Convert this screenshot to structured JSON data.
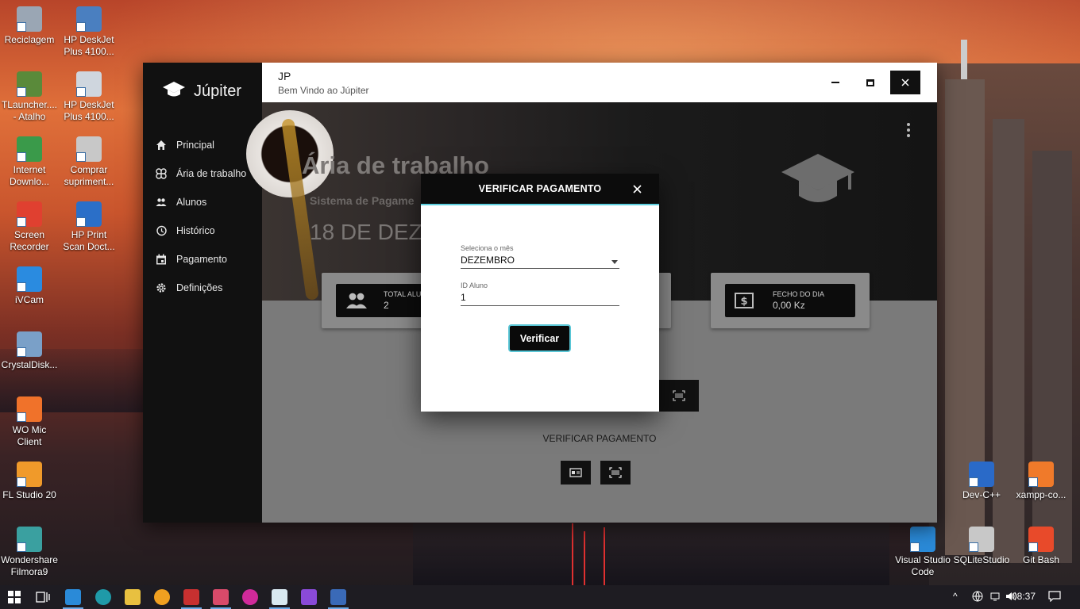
{
  "desktop": {
    "icons_left": [
      {
        "label": "Reciclagem",
        "icon": "recycle-bin-icon",
        "color": "#9aa6b4"
      },
      {
        "label": "HP DeskJet Plus 4100...",
        "icon": "printer-icon",
        "color": "#4a7fc0"
      },
      {
        "label": "TLauncher.... - Atalho",
        "icon": "minecraft-icon",
        "color": "#5a8a3a"
      },
      {
        "label": "HP DeskJet Plus 4100...",
        "icon": "printer-icon",
        "color": "#cfd6de"
      },
      {
        "label": "Internet Downlo...",
        "icon": "download-manager-icon",
        "color": "#3a9a4a"
      },
      {
        "label": "Comprar supriment...",
        "icon": "printer-cart-icon",
        "color": "#c8c8c8"
      },
      {
        "label": "Screen Recorder",
        "icon": "screen-recorder-icon",
        "color": "#e04030"
      },
      {
        "label": "HP Print Scan Doct...",
        "icon": "scan-doctor-icon",
        "color": "#2b6fc8"
      },
      {
        "label": "iVCam",
        "icon": "webcam-icon",
        "color": "#2a8be0"
      },
      {
        "label": "CrystalDisk...",
        "icon": "disk-icon",
        "color": "#7aa0c8"
      },
      {
        "label": "WO Mic Client",
        "icon": "microphone-icon",
        "color": "#f0722a"
      },
      {
        "label": "FL Studio 20",
        "icon": "fl-studio-icon",
        "color": "#f09a2a"
      },
      {
        "label": "Wondershare Filmora9",
        "icon": "filmora-icon",
        "color": "#3aa0a0"
      }
    ],
    "icons_right": [
      {
        "label": "Dev-C++",
        "icon": "devcpp-icon",
        "color": "#2a6ac8"
      },
      {
        "label": "xampp-co...",
        "icon": "xampp-icon",
        "color": "#f07a2a"
      },
      {
        "label": "Visual Studio Code",
        "icon": "vscode-icon",
        "color": "#2a8ad8"
      },
      {
        "label": "SQLiteStudio",
        "icon": "database-icon",
        "color": "#c8c8c8"
      },
      {
        "label": "Git Bash",
        "icon": "git-icon",
        "color": "#e84a2a"
      }
    ]
  },
  "app": {
    "brand": "Júpiter",
    "nav": [
      {
        "label": "Principal",
        "icon": "home-icon"
      },
      {
        "label": "Ária de trabalho",
        "icon": "command-icon"
      },
      {
        "label": "Alunos",
        "icon": "people-icon"
      },
      {
        "label": "Histórico",
        "icon": "history-icon"
      },
      {
        "label": "Pagamento",
        "icon": "calendar-icon"
      },
      {
        "label": "Definições",
        "icon": "gear-icon"
      }
    ],
    "titlebar": {
      "title": "JP",
      "subtitle": "Bem Vindo ao  Júpiter"
    },
    "hero": {
      "title": "Ária de trabalho",
      "subtitle": "Sistema de Pagame",
      "date": "18 DE DEZ"
    },
    "cards": [
      {
        "label": "TOTAL ALU",
        "value": "2",
        "icon": "people-icon"
      },
      {
        "label": "FECHO DO DIA",
        "value": "0,00 Kz",
        "icon": "money-icon"
      }
    ],
    "verify_label": "VERIFICAR PAGAMENTO"
  },
  "modal": {
    "title": "VERIFICAR PAGAMENTO",
    "month_label": "Seleciona o mês",
    "month_value": "DEZEMBRO",
    "id_label": "ID Aluno",
    "id_value": "1",
    "button": "Verificar",
    "accent": "#5fd0e0"
  },
  "taskbar": {
    "time": "08:37"
  }
}
